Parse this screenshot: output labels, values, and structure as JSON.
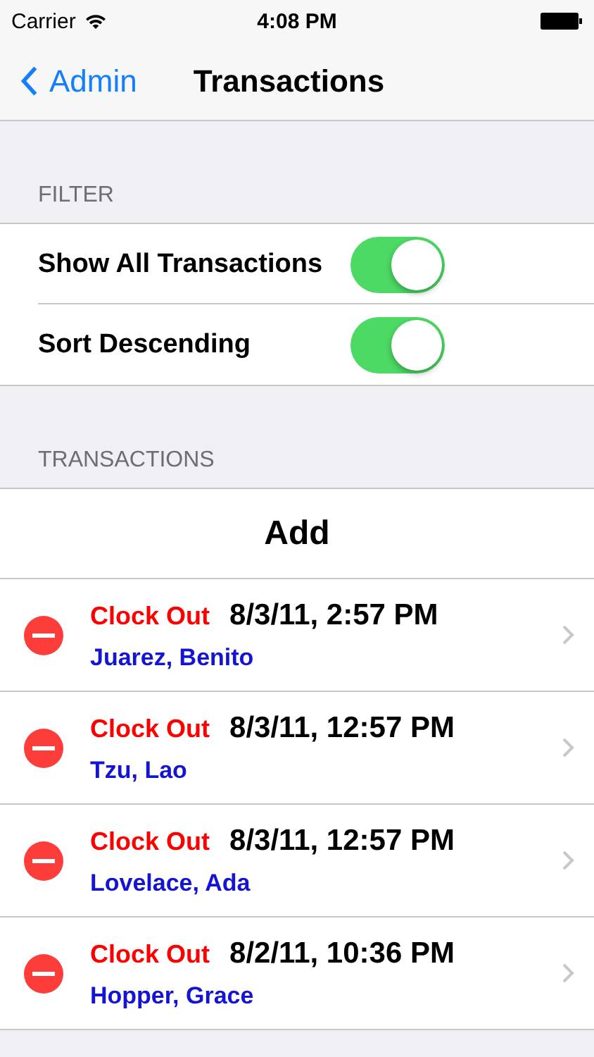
{
  "status_bar": {
    "carrier": "Carrier",
    "time": "4:08 PM"
  },
  "nav": {
    "back": "Admin",
    "title": "Transactions"
  },
  "filter": {
    "header": "FILTER",
    "rows": [
      {
        "label": "Show All Transactions",
        "on": true
      },
      {
        "label": "Sort Descending",
        "on": true
      }
    ]
  },
  "transactions": {
    "header": "TRANSACTIONS",
    "add": "Add",
    "rows": [
      {
        "action": "Clock Out",
        "date": "8/3/11, 2:57 PM",
        "name": "Juarez, Benito"
      },
      {
        "action": "Clock Out",
        "date": "8/3/11, 12:57 PM",
        "name": "Tzu, Lao"
      },
      {
        "action": "Clock Out",
        "date": "8/3/11, 12:57 PM",
        "name": "Lovelace, Ada"
      },
      {
        "action": "Clock Out",
        "date": "8/2/11, 10:36 PM",
        "name": "Hopper, Grace"
      }
    ]
  }
}
